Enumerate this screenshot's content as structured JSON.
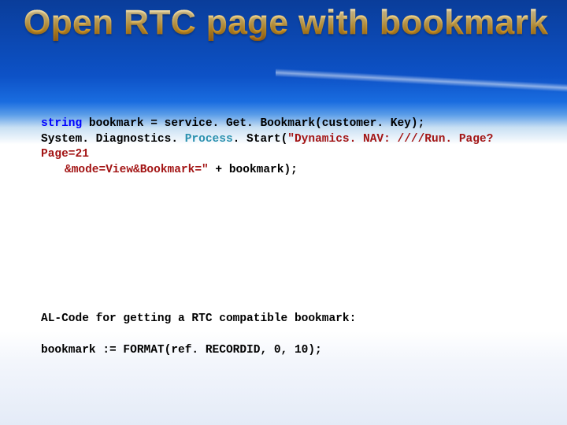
{
  "title": "Open RTC page with bookmark",
  "code": {
    "l1": {
      "kw": "string",
      "rest": " bookmark = service. Get. Bookmark(customer. Key);"
    },
    "l2": {
      "a": "System. Diagnostics. ",
      "type": "Process",
      "b": ". Start(",
      "str1": "\"Dynamics. NAV: ////Run. Page? Page=21"
    },
    "l3": {
      "str2": "&mode=View&Bookmark=\"",
      "rest": " + bookmark);"
    }
  },
  "note": "AL-Code for getting a RTC compatible bookmark:",
  "al": "bookmark := FORMAT(ref. RECORDID, 0, 10);"
}
